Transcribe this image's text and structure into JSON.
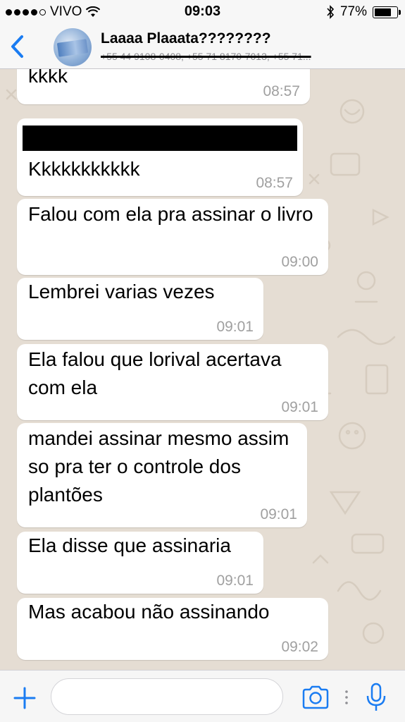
{
  "status_bar": {
    "carrier": "VIVO",
    "time": "09:03",
    "battery": "77%",
    "battery_level": 0.77
  },
  "header": {
    "back_icon": "chevron-left-icon",
    "title": "Laaaa Plaaata????????",
    "subtitle": "+55 44 9108-0408, +55 71 8170-7013, +55 71..."
  },
  "messages": [
    {
      "text": "kkkk",
      "time": "08:57"
    },
    {
      "text": "Kkkkkkkkkkk",
      "time": "08:57",
      "redacted_sender": true
    },
    {
      "text": "Falou com ela pra assinar o livro",
      "time": "09:00"
    },
    {
      "text": "Lembrei varias vezes",
      "time": "09:01"
    },
    {
      "text": "Ela falou que lorival acertava com ela",
      "time": "09:01"
    },
    {
      "text": "mandei assinar mesmo assim so pra ter o controle dos plantões",
      "time": "09:01"
    },
    {
      "text": "Ela disse que assinaria",
      "time": "09:01"
    },
    {
      "text": "Mas acabou não assinando",
      "time": "09:02"
    }
  ],
  "input_bar": {
    "plus_icon": "plus-icon",
    "message_value": "",
    "camera_icon": "camera-icon",
    "mic_icon": "microphone-icon"
  },
  "colors": {
    "accent": "#1a7cf2",
    "chat_background": "#e5ddd3",
    "bubble": "#ffffff",
    "timestamp": "#a0a0a0"
  }
}
